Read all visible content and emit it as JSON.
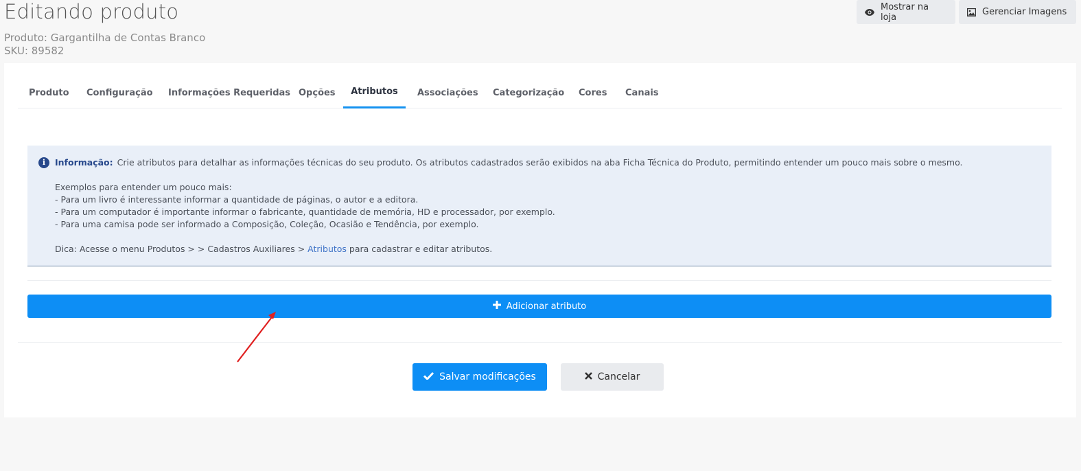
{
  "header": {
    "title": "Editando produto",
    "product_line": "Produto: Gargantilha de Contas Branco",
    "sku_line": "SKU: 89582",
    "buttons": {
      "show_store": "Mostrar na loja",
      "manage_images": "Gerenciar Imagens"
    }
  },
  "tabs": [
    {
      "label": "Produto"
    },
    {
      "label": "Configuração"
    },
    {
      "label": "Informações Requeridas"
    },
    {
      "label": "Opções"
    },
    {
      "label": "Atributos",
      "active": true
    },
    {
      "label": "Associações"
    },
    {
      "label": "Categorização"
    },
    {
      "label": "Cores"
    },
    {
      "label": "Canais"
    }
  ],
  "info": {
    "label": "Informação:",
    "text": "Crie atributos para detalhar as informações técnicas do seu produto. Os atributos cadastrados serão exibidos na aba Ficha Técnica do Produto, permitindo entender um pouco mais sobre o mesmo.",
    "examples_title": "Exemplos para entender um pouco mais:",
    "examples": [
      "- Para um livro é interessante informar a quantidade de páginas, o autor e a editora.",
      "- Para um computador é importante informar o fabricante, quantidade de memória, HD e processador, por exemplo.",
      "- Para uma camisa pode ser informado a Composição, Coleção, Ocasião e Tendência, por exemplo."
    ],
    "tip_prefix": "Dica: Acesse o menu Produtos > > Cadastros Auxiliares >",
    "tip_link": "Atributos",
    "tip_suffix": "para cadastrar e editar atributos."
  },
  "actions": {
    "add_attribute": "Adicionar atributo",
    "save": "Salvar modificações",
    "cancel": "Cancelar"
  },
  "colors": {
    "primary": "#0d8ef5",
    "info_bg": "#e9eff8",
    "info_accent": "#27488b",
    "annotation_arrow": "#e02020"
  },
  "icons": {
    "show_store": "eye-icon",
    "manage_images": "image-icon",
    "info": "info-circle-icon",
    "add": "plus-icon",
    "save": "check-icon",
    "cancel": "times-icon",
    "annotation": "red-arrow-annotation"
  }
}
